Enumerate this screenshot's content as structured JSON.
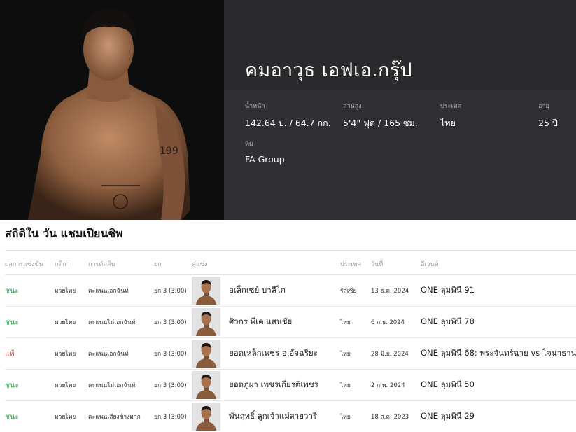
{
  "fighter": {
    "name": "คมอาวุธ เอฟเอ.กรุ๊ป",
    "stats": {
      "weight_label": "น้ำหนัก",
      "weight_value": "142.64 ป. / 64.7 กก.",
      "height_label": "ส่วนสูง",
      "height_value": "5'4\" ฟุต / 165 ซม.",
      "country_label": "ประเทศ",
      "country_value": "ไทย",
      "age_label": "อายุ",
      "age_value": "25 ปี",
      "team_label": "ทีม",
      "team_value": "FA Group"
    }
  },
  "record": {
    "title": "สถิติใน วัน แชมเปียนชิพ",
    "headers": {
      "result": "ผลการแข่งขัน",
      "discipline": "กติกา",
      "method": "การตัดสิน",
      "round": "ยก",
      "opponent": "คู่แข่ง",
      "country": "ประเทศ",
      "date": "วันที่",
      "event": "อีเวนต์"
    },
    "rows": [
      {
        "result": "ชนะ",
        "outcome": "win",
        "discipline": "มวยไทย",
        "method": "คะแนนเอกฉันท์",
        "round": "ยก 3 (3:00)",
        "opponent": "อเล็กเซย์ บาลีโก",
        "country": "รัสเซีย",
        "date": "13 ธ.ค. 2024",
        "event": "ONE ลุมพินี 91"
      },
      {
        "result": "ชนะ",
        "outcome": "win",
        "discipline": "มวยไทย",
        "method": "คะแนนไม่เอกฉันท์",
        "round": "ยก 3 (3:00)",
        "opponent": "ศิวกร พีเค.แสนชัย",
        "country": "ไทย",
        "date": "6 ก.ย. 2024",
        "event": "ONE ลุมพินี 78"
      },
      {
        "result": "แพ้",
        "outcome": "loss",
        "discipline": "มวยไทย",
        "method": "คะแนนเอกฉันท์",
        "round": "ยก 3 (3:00)",
        "opponent": "ยอดเหล็กเพชร อ.อัจฉริยะ",
        "country": "ไทย",
        "date": "28 มิ.ย. 2024",
        "event": "ONE ลุมพินี 68: พระจันทร์ฉาย vs โจนาธาน"
      },
      {
        "result": "ชนะ",
        "outcome": "win",
        "discipline": "มวยไทย",
        "method": "คะแนนไม่เอกฉันท์",
        "round": "ยก 3 (3:00)",
        "opponent": "ยอดภูผา เพชรเกียรติเพชร",
        "country": "ไทย",
        "date": "2 ก.พ. 2024",
        "event": "ONE ลุมพินี 50"
      },
      {
        "result": "ชนะ",
        "outcome": "win",
        "discipline": "มวยไทย",
        "method": "คะแนนเสียงข้างมาก",
        "round": "ยก 3 (3:00)",
        "opponent": "พันฤทธิ์ ลูกเจ้าแม่สายวารี",
        "country": "ไทย",
        "date": "18 ส.ค. 2023",
        "event": "ONE ลุมพินี 29"
      }
    ]
  },
  "colors": {
    "win": "#3aa65a",
    "loss": "#e0463c",
    "hero_bg": "#2a2a2d",
    "stats_bg": "#303034"
  }
}
